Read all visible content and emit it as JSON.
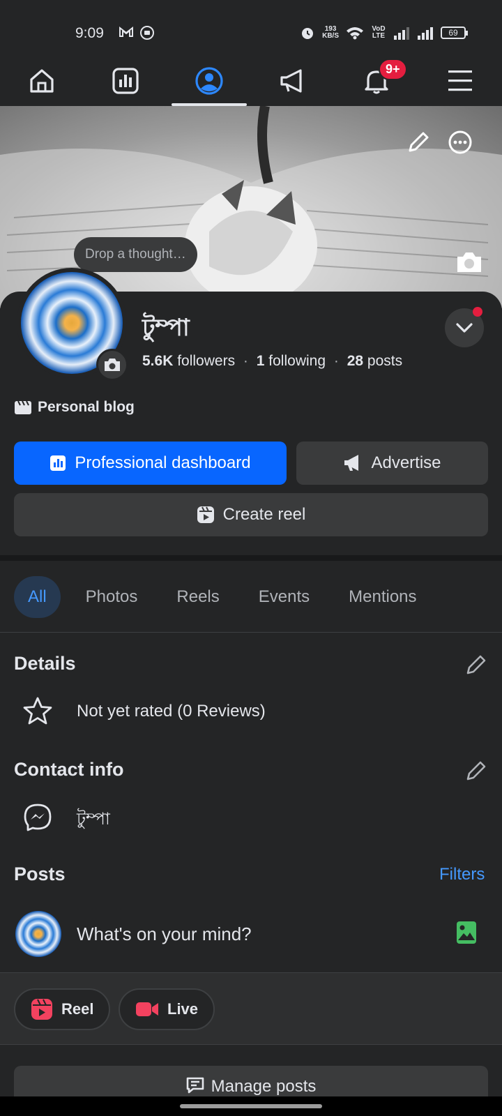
{
  "status_bar": {
    "time": "9:09",
    "net_speed_value": "193",
    "net_speed_unit": "KB/S",
    "carrier_badge": "VoD LTE",
    "battery": "69"
  },
  "top_nav": {
    "items": [
      "home-icon",
      "dashboard-icon",
      "profile-icon",
      "megaphone-icon",
      "bell-icon",
      "menu-icon"
    ],
    "active": "profile-icon",
    "notification_badge": "9+"
  },
  "profile": {
    "thought_placeholder": "Drop a thought…",
    "name": "টুম্পা",
    "followers_count": "5.6K",
    "followers_label": "followers",
    "following_count": "1",
    "following_label": "following",
    "posts_count": "28",
    "posts_label": "posts",
    "category": "Personal blog"
  },
  "buttons": {
    "professional_dashboard": "Professional dashboard",
    "advertise": "Advertise",
    "create_reel": "Create reel"
  },
  "tabs": [
    "All",
    "Photos",
    "Reels",
    "Events",
    "Mentions"
  ],
  "active_tab": "All",
  "details": {
    "title": "Details",
    "rating_text": "Not yet rated (0 Reviews)"
  },
  "contact": {
    "title": "Contact info",
    "messenger_name": "টুম্পা"
  },
  "posts": {
    "title": "Posts",
    "filters": "Filters",
    "composer_placeholder": "What's on your mind?",
    "reel_label": "Reel",
    "live_label": "Live",
    "manage_label": "Manage posts"
  },
  "colors": {
    "accent": "#0866ff",
    "link": "#4599ff",
    "badge": "#e41e3f",
    "background": "#242526"
  }
}
